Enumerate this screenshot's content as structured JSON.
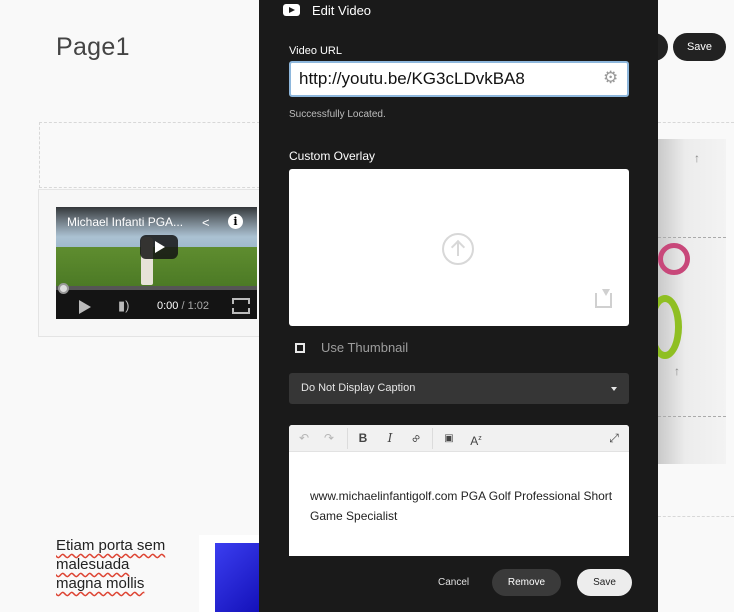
{
  "page": {
    "title": "Page1",
    "save_label": "Save",
    "lorem_text": "Etiam porta sem malesuada magna mollis"
  },
  "video_preview": {
    "title": "Michael Infanti PGA...",
    "time_current": "0:00",
    "time_total": "/ 1:02"
  },
  "modal": {
    "title": "Edit Video",
    "video_url_label": "Video URL",
    "video_url_value": "http://youtu.be/KG3cLDvkBA8",
    "status": "Successfully Located.",
    "custom_overlay_label": "Custom Overlay",
    "use_thumbnail_label": "Use Thumbnail",
    "caption_option": "Do Not Display Caption",
    "editor_text": "www.michaelinfantigolf.com PGA Golf Professional Short Game Specialist",
    "cancel_label": "Cancel",
    "remove_label": "Remove",
    "save_label": "Save"
  },
  "icons": {
    "modal": "video-icon",
    "url_settings": "gear-icon",
    "overlay_upload": "upload-icon",
    "overlay_download": "download-icon",
    "toolbar": [
      "undo-icon",
      "redo-icon",
      "bold-icon",
      "italic-icon",
      "link-icon",
      "insert-icon",
      "font-icon",
      "fullscreen-icon"
    ]
  },
  "colors": {
    "modal_bg": "#1a1a1a",
    "input_focus": "#8eb7dc",
    "accent_gear_pink": "#c8487a",
    "accent_gear_green": "#8fbf22"
  }
}
